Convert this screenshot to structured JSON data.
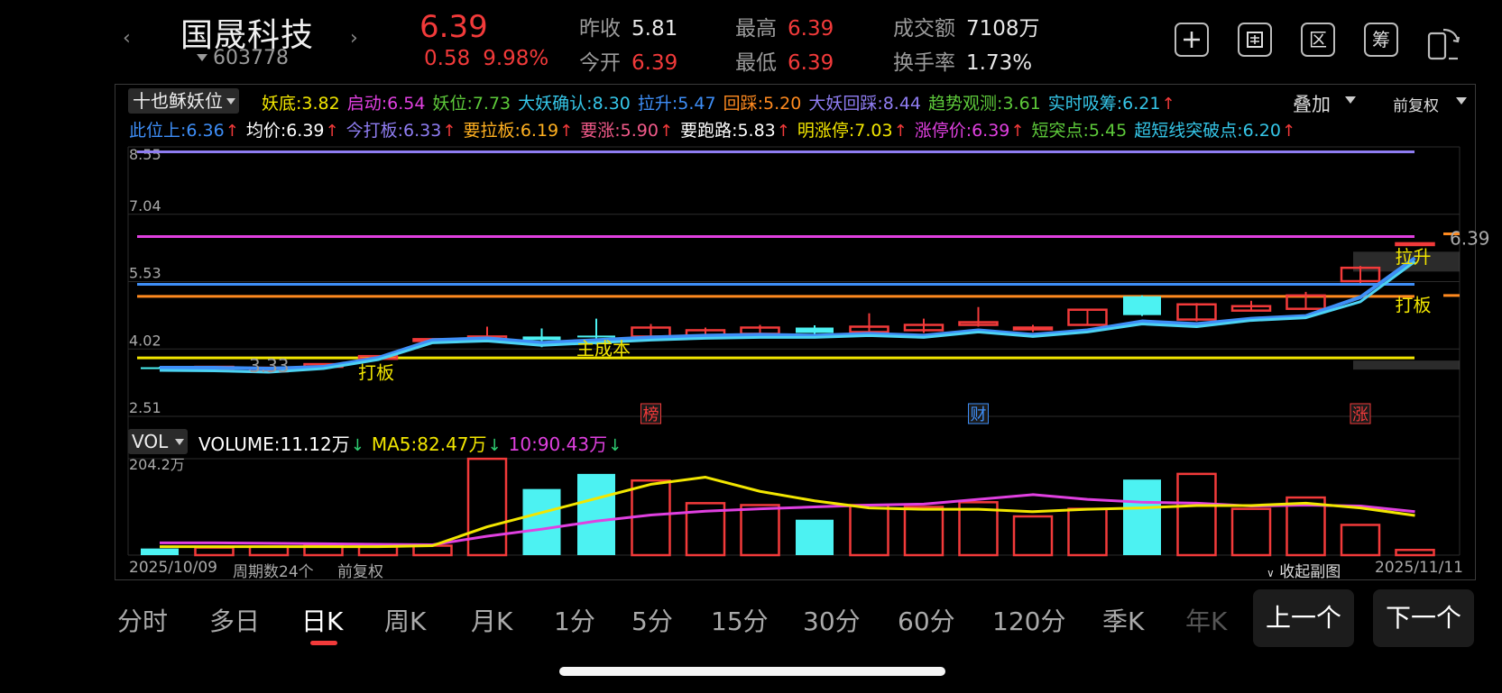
{
  "header": {
    "name": "国晟科技",
    "code": "603778",
    "price": "6.39",
    "change": "0.58",
    "change_pct": "9.98%",
    "stats": [
      {
        "label": "昨收",
        "value": "5.81",
        "color": "white"
      },
      {
        "label": "最高",
        "value": "6.39",
        "color": "red"
      },
      {
        "label": "成交额",
        "value": "7108万",
        "color": "white"
      },
      {
        "label": "今开",
        "value": "6.39",
        "color": "red"
      },
      {
        "label": "最低",
        "value": "6.39",
        "color": "red"
      },
      {
        "label": "换手率",
        "value": "1.73%",
        "color": "white"
      }
    ],
    "tools": [
      "plus-icon",
      "drawing-icon",
      "区",
      "筹"
    ]
  },
  "indicator": {
    "name": "十也稣妖位",
    "overlay": "叠加",
    "adjust": "前复权",
    "row1": [
      {
        "label": "妖底:",
        "value": "3.82",
        "color": "#f2e600",
        "arrow": ""
      },
      {
        "label": "启动:",
        "value": "6.54",
        "color": "#e040e0",
        "arrow": ""
      },
      {
        "label": "妖位:",
        "value": "7.73",
        "color": "#5dc93a",
        "arrow": ""
      },
      {
        "label": "大妖确认:",
        "value": "8.30",
        "color": "#35c6e8",
        "arrow": ""
      },
      {
        "label": "拉升:",
        "value": "5.47",
        "color": "#3e8ef7",
        "arrow": ""
      },
      {
        "label": "回踩:",
        "value": "5.20",
        "color": "#ff8a1f",
        "arrow": ""
      },
      {
        "label": "大妖回踩:",
        "value": "8.44",
        "color": "#8f7df2",
        "arrow": ""
      },
      {
        "label": "趋势观测:",
        "value": "3.61",
        "color": "#5dc93a",
        "arrow": ""
      },
      {
        "label": "实时吸筹:",
        "value": "6.21",
        "color": "#35c6e8",
        "arrow": "↑"
      }
    ],
    "row2": [
      {
        "label": "此位上:",
        "value": "6.36",
        "color": "#3e8ef7",
        "arrow": "↑"
      },
      {
        "label": "均价:",
        "value": "6.39",
        "color": "#ffffff",
        "arrow": "↑"
      },
      {
        "label": "今打板:",
        "value": "6.33",
        "color": "#8f7df2",
        "arrow": "↑"
      },
      {
        "label": "要拉板:",
        "value": "6.19",
        "color": "#ffb020",
        "arrow": "↑"
      },
      {
        "label": "要涨:",
        "value": "5.90",
        "color": "#f25a8a",
        "arrow": "↑"
      },
      {
        "label": "要跑路:",
        "value": "5.83",
        "color": "#ffffff",
        "arrow": "↑"
      },
      {
        "label": "明涨停:",
        "value": "7.03",
        "color": "#f2e600",
        "arrow": "↑"
      },
      {
        "label": "涨停价:",
        "value": "6.39",
        "color": "#e040e0",
        "arrow": "↑"
      },
      {
        "label": "短突点:",
        "value": "5.45",
        "color": "#5dc93a",
        "arrow": ""
      },
      {
        "label": "超短线突破点:",
        "value": "6.20",
        "color": "#35c6e8",
        "arrow": "↑"
      }
    ]
  },
  "volume": {
    "name": "VOL",
    "items": [
      {
        "label": "VOLUME:",
        "value": "11.12万",
        "color": "#ffffff",
        "arrow": "↓"
      },
      {
        "label": "MA5:",
        "value": "82.47万",
        "color": "#f2e600",
        "arrow": "↓"
      },
      {
        "label": "10:",
        "value": "90.43万",
        "color": "#e040e0",
        "arrow": "↓"
      }
    ],
    "axis_max_label": "204.2万"
  },
  "footer": {
    "start_date": "2025/10/09",
    "period_count": "周期数24个",
    "adjust": "前复权",
    "collapse": "收起副图",
    "end_date": "2025/11/11"
  },
  "tabs": [
    "分时",
    "多日",
    "日K",
    "周K",
    "月K",
    "1分",
    "5分",
    "15分",
    "30分",
    "60分",
    "120分",
    "季K",
    "年K"
  ],
  "active_tab": "日K",
  "nav_buttons": {
    "prev": "上一个",
    "next": "下一个"
  },
  "chart_data": {
    "type": "candlestick",
    "y_ticks": [
      "8.55",
      "7.04",
      "5.53",
      "4.02",
      "2.51"
    ],
    "ylim": [
      2.51,
      8.55
    ],
    "levels": [
      {
        "price": 8.44,
        "color": "#8f7df2"
      },
      {
        "price": 6.54,
        "color": "#e040e0"
      },
      {
        "price": 5.47,
        "color": "#3e8ef7"
      },
      {
        "price": 5.2,
        "color": "#ff8a1f"
      },
      {
        "price": 3.82,
        "color": "#f2e600"
      }
    ],
    "candles": [
      {
        "o": 3.61,
        "c": 3.61,
        "h": 3.62,
        "l": 3.6,
        "up": false
      },
      {
        "o": 3.62,
        "c": 3.6,
        "h": 3.64,
        "l": 3.58,
        "up": true
      },
      {
        "o": 3.6,
        "c": 3.52,
        "h": 3.62,
        "l": 3.5,
        "up": true
      },
      {
        "o": 3.62,
        "c": 3.68,
        "h": 3.7,
        "l": 3.6,
        "up": true
      },
      {
        "o": 3.8,
        "c": 3.86,
        "h": 3.88,
        "l": 3.78,
        "up": true
      },
      {
        "o": 4.24,
        "c": 4.24,
        "h": 4.25,
        "l": 4.23,
        "up": true
      },
      {
        "o": 4.22,
        "c": 4.3,
        "h": 4.52,
        "l": 4.2,
        "up": true
      },
      {
        "o": 4.3,
        "c": 4.22,
        "h": 4.48,
        "l": 4.06,
        "up": false
      },
      {
        "o": 4.3,
        "c": 4.32,
        "h": 4.7,
        "l": 4.12,
        "up": false
      },
      {
        "o": 4.3,
        "c": 4.5,
        "h": 4.58,
        "l": 4.22,
        "up": true
      },
      {
        "o": 4.32,
        "c": 4.44,
        "h": 4.5,
        "l": 4.3,
        "up": true
      },
      {
        "o": 4.36,
        "c": 4.5,
        "h": 4.56,
        "l": 4.32,
        "up": true
      },
      {
        "o": 4.5,
        "c": 4.38,
        "h": 4.55,
        "l": 4.34,
        "up": false
      },
      {
        "o": 4.4,
        "c": 4.52,
        "h": 4.82,
        "l": 4.36,
        "up": true
      },
      {
        "o": 4.44,
        "c": 4.56,
        "h": 4.7,
        "l": 4.38,
        "up": true
      },
      {
        "o": 4.56,
        "c": 4.62,
        "h": 4.96,
        "l": 4.52,
        "up": true
      },
      {
        "o": 4.46,
        "c": 4.5,
        "h": 4.56,
        "l": 4.4,
        "up": true
      },
      {
        "o": 4.56,
        "c": 4.9,
        "h": 4.92,
        "l": 4.54,
        "up": true
      },
      {
        "o": 4.78,
        "c": 5.2,
        "h": 5.22,
        "l": 4.76,
        "up": false
      },
      {
        "o": 4.68,
        "c": 5.02,
        "h": 5.05,
        "l": 4.64,
        "up": true
      },
      {
        "o": 4.88,
        "c": 4.98,
        "h": 5.1,
        "l": 4.86,
        "up": true
      },
      {
        "o": 4.92,
        "c": 5.22,
        "h": 5.3,
        "l": 4.9,
        "up": true
      },
      {
        "o": 5.54,
        "c": 5.84,
        "h": 5.88,
        "l": 5.5,
        "up": true
      },
      {
        "o": 6.39,
        "c": 6.39,
        "h": 6.39,
        "l": 6.39,
        "up": true
      }
    ],
    "ma_a": [
      3.54,
      3.53,
      3.5,
      3.58,
      3.78,
      4.16,
      4.2,
      4.1,
      4.16,
      4.22,
      4.26,
      4.28,
      4.28,
      4.32,
      4.28,
      4.4,
      4.3,
      4.4,
      4.58,
      4.52,
      4.66,
      4.72,
      5.08,
      5.98
    ],
    "ma_b": [
      3.6,
      3.6,
      3.58,
      3.62,
      3.82,
      4.22,
      4.26,
      4.16,
      4.22,
      4.28,
      4.32,
      4.34,
      4.32,
      4.36,
      4.32,
      4.44,
      4.34,
      4.44,
      4.64,
      4.58,
      4.7,
      4.76,
      5.18,
      6.06
    ],
    "annotations": [
      {
        "text": "3.33",
        "candle": 2,
        "price": 3.5,
        "color": "#9a9a9a"
      },
      {
        "text": "打板",
        "candle": 4,
        "price": 3.35,
        "color": "#f2e600"
      },
      {
        "text": "主成本",
        "candle": 8,
        "price": 3.88,
        "color": "#f2e600"
      },
      {
        "text": "拉升",
        "candle": 23,
        "price": 5.94,
        "color": "#f2e600"
      },
      {
        "text": "打板",
        "candle": 23,
        "price": 4.86,
        "color": "#f2e600"
      },
      {
        "text": "6.39",
        "candle": 24,
        "price": 6.36,
        "color": "#aaaaaa"
      }
    ],
    "markers": [
      {
        "text": "榜",
        "candle": 9,
        "color": "#f23a3a"
      },
      {
        "text": "财",
        "candle": 15,
        "color": "#3e8ef7"
      },
      {
        "text": "涨",
        "candle": 22,
        "color": "#f23a3a"
      }
    ],
    "vol_max": 204.2,
    "vol_values": [
      14,
      16,
      18,
      20,
      18,
      20,
      204,
      140,
      172,
      158,
      110,
      106,
      75,
      106,
      102,
      112,
      82,
      98,
      160,
      172,
      98,
      122,
      64,
      11
    ],
    "vol_up": [
      false,
      true,
      true,
      true,
      true,
      true,
      true,
      false,
      false,
      true,
      true,
      true,
      false,
      true,
      true,
      true,
      true,
      true,
      false,
      true,
      true,
      true,
      true,
      true
    ],
    "vol_ma5": [
      18,
      18,
      18,
      18,
      18,
      20,
      60,
      90,
      120,
      150,
      165,
      135,
      115,
      100,
      97,
      97,
      92,
      97,
      100,
      105,
      105,
      110,
      100,
      84
    ],
    "vol_ma10": [
      26,
      26,
      25,
      24,
      23,
      22,
      40,
      55,
      72,
      85,
      93,
      98,
      102,
      106,
      108,
      118,
      128,
      118,
      112,
      110,
      104,
      106,
      104,
      92
    ]
  }
}
